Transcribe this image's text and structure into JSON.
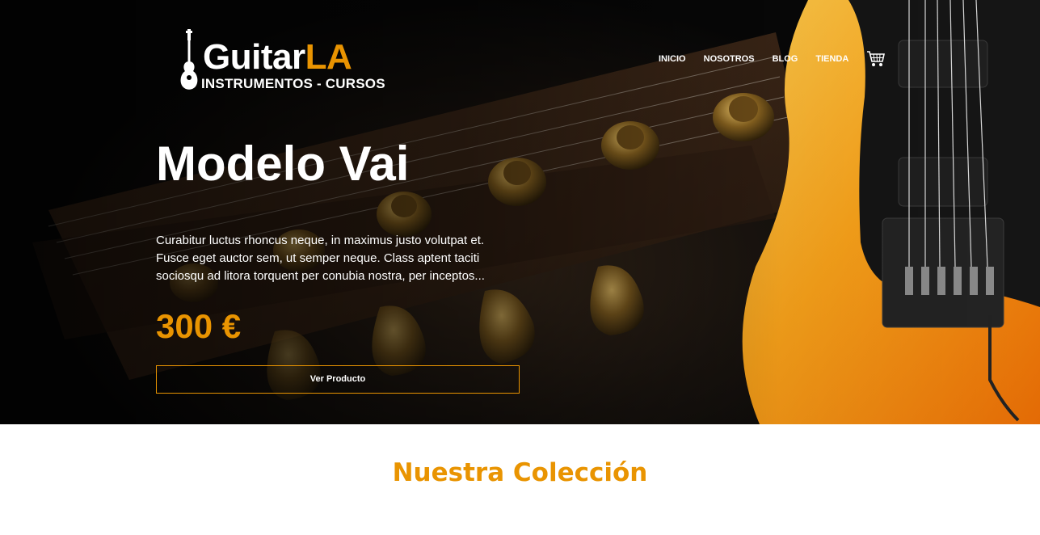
{
  "header": {
    "logo": {
      "name_main": "Guitar",
      "name_accent": "LA",
      "tagline": "INSTRUMENTOS - CURSOS"
    },
    "nav": [
      {
        "label": "INICIO"
      },
      {
        "label": "NOSOTROS"
      },
      {
        "label": "BLOG"
      },
      {
        "label": "TIENDA"
      }
    ],
    "cart_icon": "shopping-cart-icon"
  },
  "hero": {
    "title": "Modelo Vai",
    "description": "Curabitur luctus rhoncus neque, in maximus justo volutpat et. Fusce eget auctor sem, ut semper neque. Class aptent taciti sociosqu ad litora torquent per conubia nostra, per inceptos...",
    "price": "300 €",
    "button_label": "Ver Producto"
  },
  "collection": {
    "title": "Nuestra Colección"
  },
  "colors": {
    "accent": "#e99401",
    "background": "#000000",
    "text": "#ffffff"
  }
}
